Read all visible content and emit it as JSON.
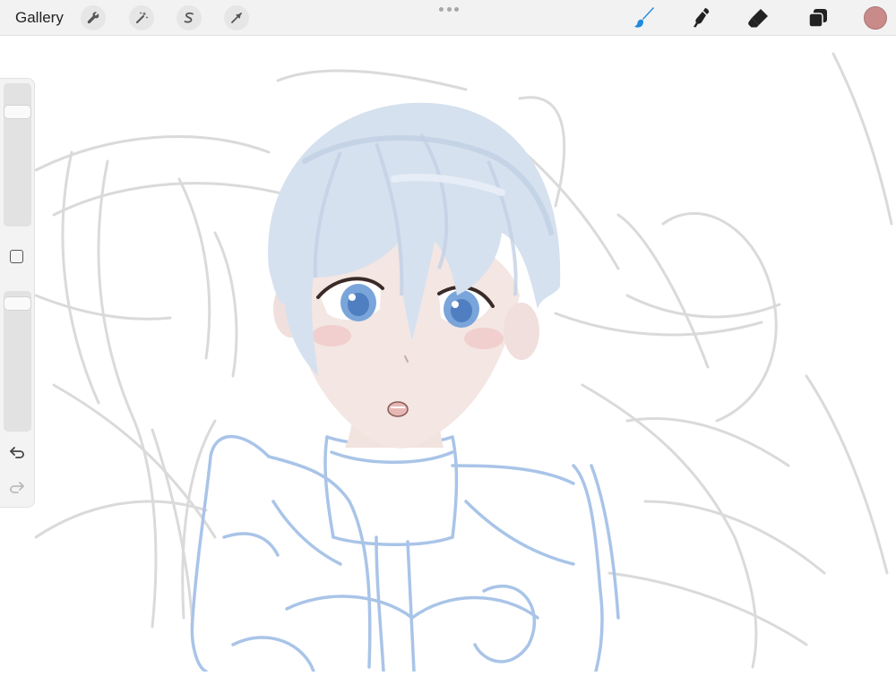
{
  "toolbar": {
    "gallery_label": "Gallery",
    "left_tools": [
      "wrench-icon",
      "magic-wand-icon",
      "selection-s-icon",
      "transform-arrow-icon"
    ],
    "right_tools": {
      "brush": {
        "icon": "brush-icon",
        "active": true,
        "color": "#1e8be0"
      },
      "smudge": {
        "icon": "smudge-icon"
      },
      "eraser": {
        "icon": "eraser-icon"
      },
      "layers": {
        "icon": "layers-icon"
      }
    },
    "current_color": "#c98a8a"
  },
  "sidebar": {
    "size_slider_value": 0.83,
    "opacity_slider_value": 0.96,
    "icons": [
      "modify-square-icon",
      "undo-icon",
      "redo-icon"
    ]
  },
  "canvas": {
    "content": "sketch-drawing",
    "sketch_color": "#a9c4e8",
    "hair_color": "#d4dfee",
    "skin_color": "#f2e4e2",
    "eye_color": "#6e9bd4"
  }
}
